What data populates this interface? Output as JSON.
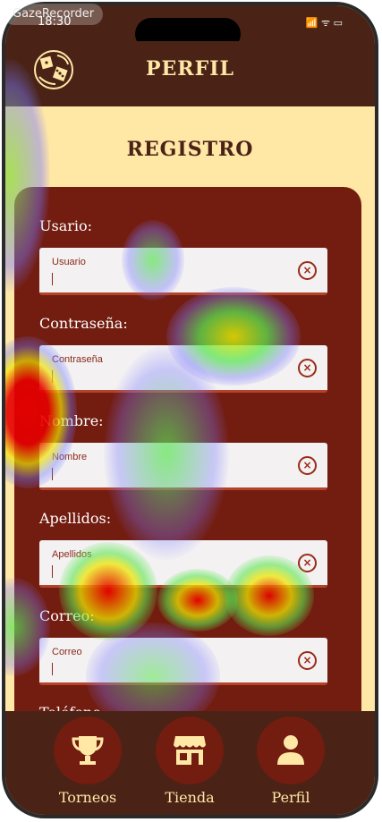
{
  "recorder": {
    "label": "GazeRecorder"
  },
  "statusbar": {
    "time": "18:30",
    "icons": "📶 ᯤ ▭"
  },
  "header": {
    "title": "PERFIL",
    "logo_icon": "dice-logo-icon"
  },
  "section": {
    "title": "REGISTRO"
  },
  "form": {
    "fields": [
      {
        "label": "Usario:",
        "placeholder": "Usuario"
      },
      {
        "label": "Contraseña:",
        "placeholder": "Contraseña"
      },
      {
        "label": "Nombre:",
        "placeholder": "Nombre"
      },
      {
        "label": "Apellidos:",
        "placeholder": "Apellidos"
      },
      {
        "label": "Correo:",
        "placeholder": "Correo"
      }
    ],
    "next_label": "Teléfono:",
    "clear_glyph": "×"
  },
  "nav": {
    "items": [
      {
        "label": "Torneos",
        "icon": "trophy-icon"
      },
      {
        "label": "Tienda",
        "icon": "store-icon"
      },
      {
        "label": "Perfil",
        "icon": "user-icon"
      }
    ]
  },
  "colors": {
    "header_bg": "#4a2316",
    "page_bg": "#ffe7a6",
    "form_bg": "#731c10",
    "field_bg": "#f3f1f2",
    "accent": "#b4432a"
  }
}
